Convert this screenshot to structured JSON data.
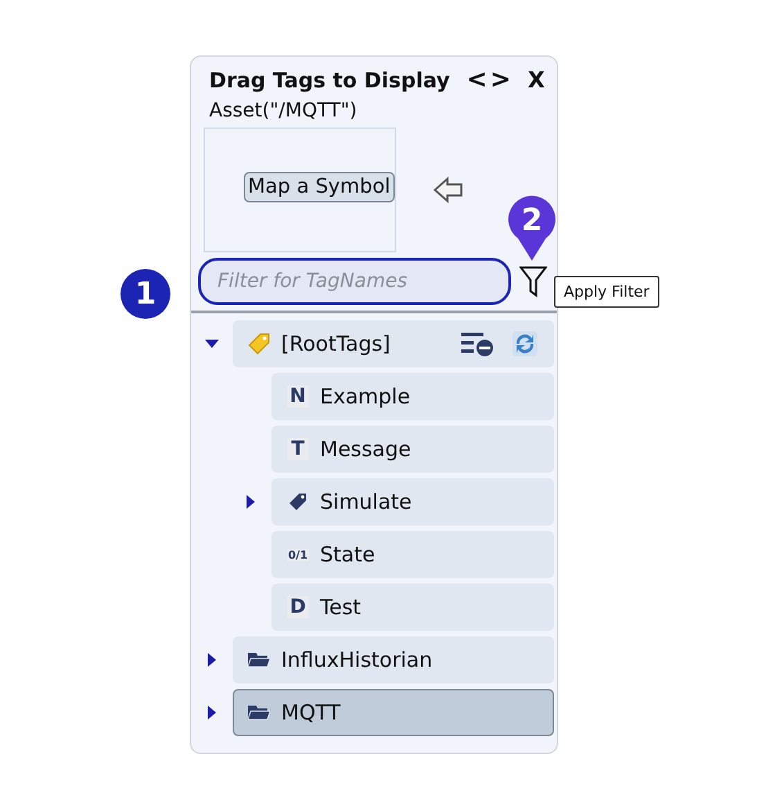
{
  "panel": {
    "title": "Drag Tags to Display",
    "nav_symbol": "<>",
    "close": "X",
    "asset": "Asset(\"/MQTT\")",
    "map_button": "Map a Symbol",
    "filter": {
      "placeholder": "Filter for TagNames",
      "focused": true
    },
    "tooltip": "Apply Filter"
  },
  "callouts": [
    {
      "label": "1"
    },
    {
      "label": "2"
    }
  ],
  "tree": [
    {
      "label": "[RootTags]",
      "kind": "root",
      "expanded": true,
      "selected": false,
      "children": [
        {
          "label": "Example",
          "kind": "type",
          "badge": "N",
          "selected": false
        },
        {
          "label": "Message",
          "kind": "type",
          "badge": "T",
          "selected": false
        },
        {
          "label": "Simulate",
          "kind": "tag",
          "expanded": false,
          "selected": false
        },
        {
          "label": "State",
          "kind": "small",
          "badge": "0/1",
          "selected": false
        },
        {
          "label": "Test",
          "kind": "type",
          "badge": "D",
          "selected": false
        }
      ]
    },
    {
      "label": "InfluxHistorian",
      "kind": "folder",
      "expanded": false,
      "selected": false
    },
    {
      "label": "MQTT",
      "kind": "folder",
      "expanded": false,
      "selected": true
    }
  ]
}
